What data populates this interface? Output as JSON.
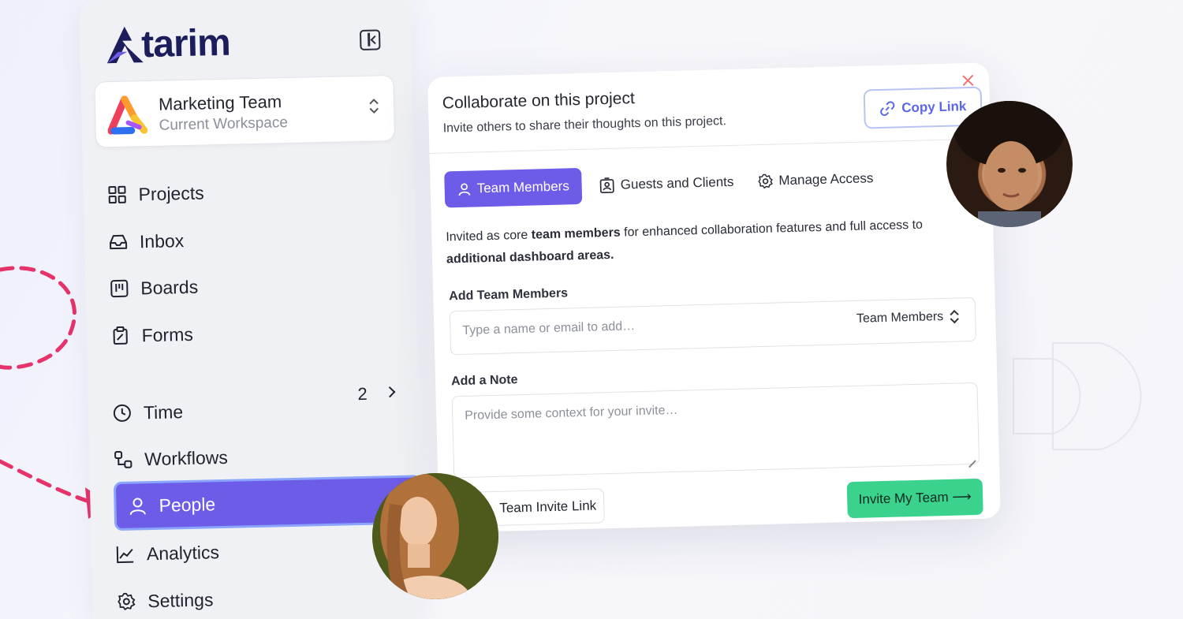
{
  "brand": {
    "logo_text": "tarim",
    "accent": "#6c5ce7",
    "success": "#3ad28c"
  },
  "workspace": {
    "name": "Marketing Team",
    "subtitle": "Current Workspace"
  },
  "sidebar": {
    "items": [
      {
        "label": "Projects",
        "icon": "grid-icon"
      },
      {
        "label": "Inbox",
        "icon": "inbox-icon"
      },
      {
        "label": "Boards",
        "icon": "board-icon"
      },
      {
        "label": "Forms",
        "icon": "clipboard-icon"
      },
      {
        "label": "Time",
        "icon": "clock-icon",
        "count": "2"
      },
      {
        "label": "Workflows",
        "icon": "workflow-icon"
      },
      {
        "label": "People",
        "icon": "person-icon",
        "active": true
      },
      {
        "label": "Analytics",
        "icon": "chart-icon"
      },
      {
        "label": "Settings",
        "icon": "gear-icon"
      }
    ]
  },
  "modal": {
    "title": "Collaborate on this project",
    "subtitle": "Invite others to share their thoughts on this project.",
    "copy_link_label": "Copy Link",
    "tabs": [
      {
        "label": "Team Members",
        "active": true,
        "icon": "person-icon"
      },
      {
        "label": "Guests and Clients",
        "icon": "badge-icon"
      },
      {
        "label": "Manage Access",
        "icon": "gear-icon"
      }
    ],
    "description_pre": "Invited as core ",
    "description_bold1": "team members",
    "description_mid": " for enhanced collaboration features and full access to ",
    "description_bold2": "additional dashboard areas.",
    "add_members_label": "Add Team Members",
    "add_members_placeholder": "Type a name or email to add…",
    "role_select": "Team Members",
    "note_label": "Add a Note",
    "note_placeholder": "Provide some context for your invite…",
    "invite_link_label": "Team Invite Link",
    "invite_team_label": "Invite My Team ⟶"
  }
}
